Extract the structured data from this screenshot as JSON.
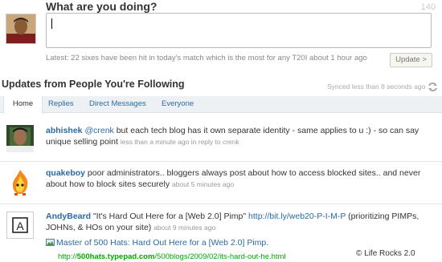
{
  "composer": {
    "question": "What are you doing?",
    "char_count": "140",
    "latest_label": "Latest:",
    "latest_text": "22 sixes have been hit in today's match which is the most for any T20I",
    "latest_time": "about 1 hour ago",
    "update_label": "Update >"
  },
  "section": {
    "title": "Updates from People You're Following",
    "synced": "Synced less than 8 seconds ago"
  },
  "tabs": [
    {
      "label": "Home"
    },
    {
      "label": "Replies"
    },
    {
      "label": "Direct Messages"
    },
    {
      "label": "Everyone"
    }
  ],
  "tweets": [
    {
      "user": "abhishek",
      "mention": "@crenk",
      "text": " but each tech blog has it own separate identity - same applies to u :) - so can say unique selling point",
      "time": "less than a minute ago",
      "reply_prefix": "in reply to",
      "reply_to": "crenk"
    },
    {
      "user": "quakeboy",
      "text": " poor administrators.. bloggers always post about how to access blocked sites.. and never about how to block sites securely",
      "time": "about 5 minutes ago"
    },
    {
      "user": "AndyBeard",
      "text": " \"It's Hard Out Here for a [Web 2.0] Pimp\"",
      "link": "http://bit.ly/web20-P-I-M-P",
      "text2": " (prioritizing PIMPs, JOHNs, & HOs on your site)",
      "time": "about 9 minutes ago",
      "preview_title": "Master of 500 Hats: Hard Out Here for a [Web 2.0] Pimp.",
      "preview_url_a": "http://",
      "preview_url_b": "500hats.typepad.com",
      "preview_url_c": "/500blogs/2009/02/its-hard-out-he.html"
    }
  ],
  "watermark": "© Life Rocks 2.0"
}
